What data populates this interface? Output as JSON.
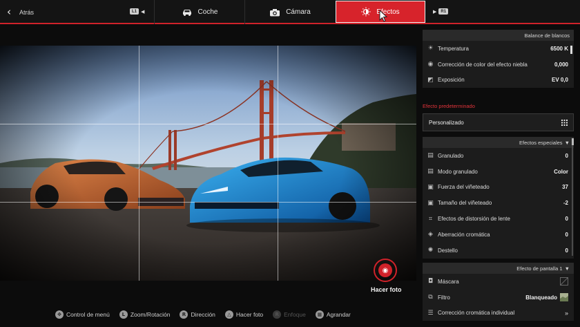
{
  "nav": {
    "back_label": "Atrás",
    "l1": "L1",
    "r1": "R1",
    "tabs": [
      {
        "label": "Coche",
        "icon": "car-icon"
      },
      {
        "label": "Cámara",
        "icon": "camera-icon"
      },
      {
        "label": "Efectos",
        "icon": "brightness-icon",
        "active": true
      }
    ]
  },
  "photo": {
    "capture_label": "Hacer foto"
  },
  "hints": [
    {
      "glyph": "✥",
      "label": "Control de menú",
      "enabled": true
    },
    {
      "glyph": "L",
      "label": "Zoom/Rotación",
      "enabled": true
    },
    {
      "glyph": "R",
      "label": "Dirección",
      "enabled": true
    },
    {
      "glyph": "△",
      "label": "Hacer foto",
      "enabled": true
    },
    {
      "glyph": "R",
      "label": "Enfoque",
      "enabled": false
    },
    {
      "glyph": "▦",
      "label": "Agrandar",
      "enabled": true
    }
  ],
  "white_balance": {
    "title": "Balance de blancos",
    "rows": [
      {
        "label": "Temperatura",
        "value": "6500 K"
      },
      {
        "label": "Corrección de color del efecto niebla",
        "value": "0,000"
      },
      {
        "label": "Exposición",
        "value": "EV 0,0"
      }
    ]
  },
  "preset": {
    "title": "Efecto predeterminado",
    "value": "Personalizado"
  },
  "special_effects": {
    "title": "Efectos especiales",
    "rows": [
      {
        "label": "Granulado",
        "value": "0"
      },
      {
        "label": "Modo granulado",
        "value": "Color"
      },
      {
        "label": "Fuerza del viñeteado",
        "value": "37"
      },
      {
        "label": "Tamaño del viñeteado",
        "value": "-2"
      },
      {
        "label": "Efectos de distorsión de lente",
        "value": "0"
      },
      {
        "label": "Aberración cromática",
        "value": "0"
      },
      {
        "label": "Destello",
        "value": "0"
      }
    ]
  },
  "screen_effect": {
    "title": "Efecto de pantalla 1",
    "rows": [
      {
        "label": "Máscara",
        "value": ""
      },
      {
        "label": "Filtro",
        "value": "Blanqueado"
      },
      {
        "label": "Corrección cromática individual",
        "value": ""
      }
    ]
  },
  "colors": {
    "accent": "#d7232b",
    "panel": "#1c1c1c",
    "background": "#0c0c0c"
  }
}
